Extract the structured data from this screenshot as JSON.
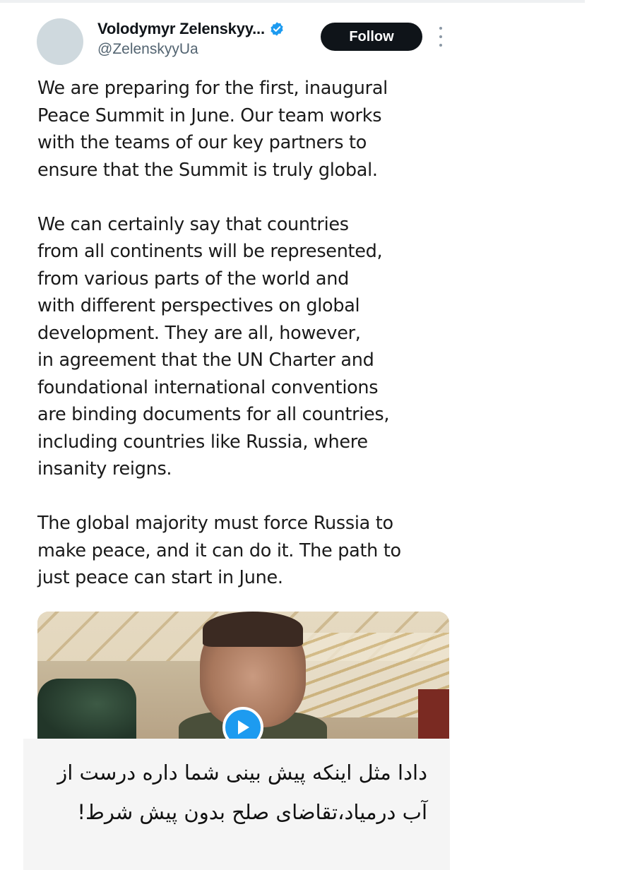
{
  "tweet": {
    "author": {
      "display_name": "Volodymyr Zelenskyy...",
      "handle": "@ZelenskyyUa",
      "verified": true,
      "avatar_icon": "avatar-placeholder"
    },
    "follow_label": "Follow",
    "more_icon": "more-dots-icon",
    "paragraphs": [
      "We are preparing for the first, inaugural\nPeace Summit in June. Our team works\nwith the teams of our key partners to\nensure that the Summit is truly global.",
      "We can certainly say that countries\nfrom all continents will be represented,\nfrom various parts of the world and\nwith different perspectives on global\ndevelopment. They are all, however,\nin agreement that the UN Charter and\nfoundational international conventions\nare binding documents for all countries,\nincluding countries like Russia, where\ninsanity reigns.",
      "The global majority must force Russia to\nmake peace, and it can do it. The path to\njust peace can start in June."
    ],
    "media": {
      "type": "video",
      "play_icon": "play-icon"
    }
  },
  "caption": {
    "text": "دادا مثل اینکه پیش بینی شما داره درست از آب درمیاد،تقاضای صلح بدون پیش شرط!"
  },
  "colors": {
    "accent": "#1d9bf0",
    "text": "#0f1419",
    "secondary_text": "#536471",
    "follow_bg": "#0f1419"
  }
}
